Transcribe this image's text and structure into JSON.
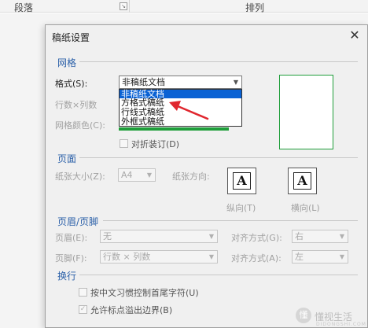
{
  "ribbon": {
    "group_paragraph": "段落",
    "group_arrange": "排列"
  },
  "dialog": {
    "title": "稿纸设置",
    "grid": {
      "section": "网格",
      "style_label": "格式(S):",
      "style_value": "非稿纸文档",
      "style_options": [
        "非稿纸文档",
        "方格式稿纸",
        "行线式稿纸",
        "外框式稿纸"
      ],
      "rows_cols_label": "行数×列数",
      "grid_color_label": "网格颜色(C):",
      "fold_label": "对折装订(D)"
    },
    "page": {
      "section": "页面",
      "paper_size_label": "纸张大小(Z):",
      "paper_size_value": "A4",
      "orientation_label": "纸张方向:",
      "portrait_label": "纵向(T)",
      "landscape_label": "横向(L)",
      "orientation_glyph": "A"
    },
    "header_footer": {
      "section": "页眉/页脚",
      "header_label": "页眉(E):",
      "header_value": "无",
      "header_align_label": "对齐方式(G):",
      "header_align_value": "右",
      "footer_label": "页脚(F):",
      "footer_value": "行数 × 列数",
      "footer_align_label": "对齐方式(A):",
      "footer_align_value": "左"
    },
    "line_break": {
      "section": "换行",
      "option1": "按中文习惯控制首尾字符(U)",
      "option2": "允许标点溢出边界(B)"
    }
  },
  "watermark": {
    "text": "懂视生活",
    "sub": "DIDONGSHI.COM"
  },
  "icons": {
    "close": "close-icon",
    "arrow": "red-pointer-arrow",
    "check": "checkmark-icon"
  },
  "colors": {
    "selection": "#0a62d4",
    "section_heading": "#2a5fa8",
    "preview_border": "#1f9e3a",
    "pointer": "#e0262e"
  }
}
